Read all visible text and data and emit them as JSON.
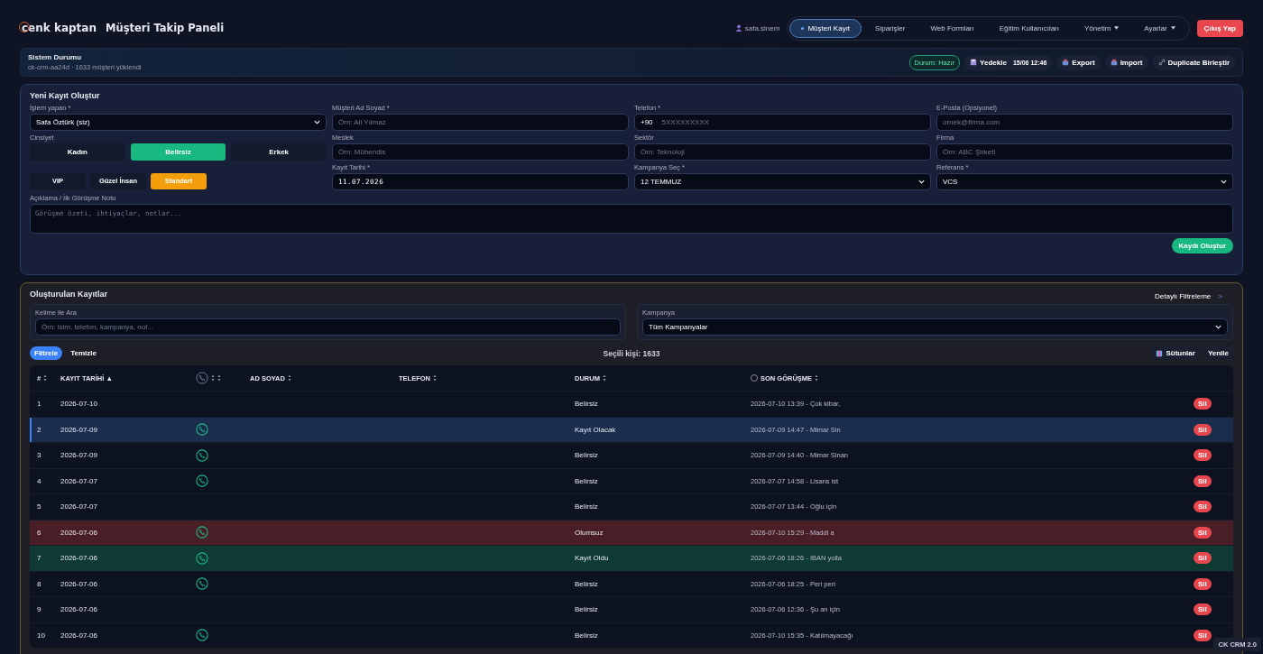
{
  "brand": {
    "logo": "cenk kaptan",
    "title": "Müşteri Takip Paneli"
  },
  "user": "safa.sinem",
  "nav": [
    {
      "label": "Müşteri Kayıt",
      "selected": true,
      "dropdown": false
    },
    {
      "label": "Siparişler",
      "selected": false,
      "dropdown": false
    },
    {
      "label": "Web Formları",
      "selected": false,
      "dropdown": false
    },
    {
      "label": "Eğitim Kullanıcıları",
      "selected": false,
      "dropdown": false
    },
    {
      "label": "Yönetim",
      "selected": false,
      "dropdown": true
    },
    {
      "label": "Ayarlar",
      "selected": false,
      "dropdown": true
    }
  ],
  "logout": "Çıkış Yap",
  "system": {
    "title": "Sistem Durumu",
    "subtitle": "ck-crm-aa24d · 1633 müşteri yüklendi",
    "status": "Durum: Hazır",
    "backup": "Yedekle",
    "backup_time": "15/06 12:46",
    "actions": [
      {
        "kind": "export",
        "label": "Export"
      },
      {
        "kind": "import",
        "label": "Import"
      },
      {
        "kind": "link",
        "label": "Duplicate Birleştir"
      }
    ]
  },
  "form": {
    "title": "Yeni Kayıt Oluştur",
    "operator": {
      "label": "İşlem yapan *",
      "value": "Safa Öztürk (siz)"
    },
    "name": {
      "label": "Müşteri Ad Soyad *",
      "placeholder": "Örn: Ali Yılmaz"
    },
    "phone": {
      "label": "Telefon *",
      "prefix": "+90",
      "placeholder": "5XXXXXXXXX"
    },
    "email": {
      "label": "E-Posta (Opsiyonel)",
      "placeholder": "ornek@firma.com"
    },
    "gender": {
      "label": "Cinsiyet",
      "options": [
        {
          "label": "Kadın",
          "selected": false
        },
        {
          "label": "Belirsiz",
          "selected": true
        },
        {
          "label": "Erkek",
          "selected": false
        }
      ]
    },
    "job": {
      "label": "Meslek",
      "placeholder": "Örn: Mühendis"
    },
    "sector": {
      "label": "Sektör",
      "placeholder": "Örn: Teknoloji"
    },
    "company": {
      "label": "Firma",
      "placeholder": "Örn: ABC Şirketi"
    },
    "segments": [
      {
        "label": "VIP",
        "selected": false
      },
      {
        "label": "Güzel İnsan",
        "selected": false
      },
      {
        "label": "Standart",
        "selected": true
      }
    ],
    "date": {
      "label": "Kayıt Tarihi *",
      "value": "11.07.2026"
    },
    "campaign": {
      "label": "Kampanya Seç *",
      "value": "12 TEMMUZ"
    },
    "reference": {
      "label": "Referans *",
      "value": "VCS"
    },
    "note": {
      "label": "Açıklama / İlk Görüşme Notu",
      "placeholder": "Görüşme özeti, ihtiyaçlar, notlar..."
    },
    "submit": "Kaydı Oluştur"
  },
  "records": {
    "title": "Oluşturulan Kayıtlar",
    "detail_filter": "Detaylı Filtreleme",
    "detail_arrow": ">",
    "search": {
      "label": "Kelime ile Ara",
      "placeholder": "Örn: isim, telefon, kampanya, not..."
    },
    "campaign": {
      "label": "Kampanya",
      "value": "Tüm Kampanyalar"
    },
    "filter": "Filtrele",
    "clear": "Temizle",
    "selected_count": "Seçili kişi: 1633",
    "columns_button": "Sütunlar",
    "refresh": "Yenile",
    "columns": [
      "#",
      "KAYIT TARİHİ ▲",
      "AD SOYAD",
      "TELEFON",
      "DURUM",
      "SON GÖRÜŞME"
    ],
    "rows": [
      {
        "no": "1",
        "date": "2026-07-10",
        "has_call": false,
        "status": "Belirsiz",
        "kind": "plain",
        "last": "2026-07-10 13:39 - Çok kibar,",
        "delete": "Sil"
      },
      {
        "no": "2",
        "date": "2026-07-09",
        "has_call": true,
        "status": "Kayıt Olacak",
        "kind": "planned",
        "last": "2026-07-09 14:47 - Mimar Sin",
        "delete": "Sil"
      },
      {
        "no": "3",
        "date": "2026-07-09",
        "has_call": true,
        "status": "Belirsiz",
        "kind": "plain",
        "last": "2026-07-09 14:40 - Mimar Sinan",
        "delete": "Sil"
      },
      {
        "no": "4",
        "date": "2026-07-07",
        "has_call": true,
        "status": "Belirsiz",
        "kind": "plain",
        "last": "2026-07-07 14:58 - Lisans ist",
        "delete": "Sil"
      },
      {
        "no": "5",
        "date": "2026-07-07",
        "has_call": false,
        "status": "Belirsiz",
        "kind": "plain",
        "last": "2026-07-07 13:44 - Oğlu için",
        "delete": "Sil"
      },
      {
        "no": "6",
        "date": "2026-07-06",
        "has_call": true,
        "status": "Olumsuz",
        "kind": "negative",
        "last": "2026-07-10 15:29 - Maddi a",
        "delete": "Sil"
      },
      {
        "no": "7",
        "date": "2026-07-06",
        "has_call": true,
        "status": "Kayıt Oldu",
        "kind": "positive",
        "last": "2026-07-06 18:26 - IBAN yolla",
        "delete": "Sil"
      },
      {
        "no": "8",
        "date": "2026-07-06",
        "has_call": true,
        "status": "Belirsiz",
        "kind": "plain",
        "last": "2026-07-06 18:25 - Peri peri",
        "delete": "Sil"
      },
      {
        "no": "9",
        "date": "2026-07-06",
        "has_call": false,
        "status": "Belirsiz",
        "kind": "plain",
        "last": "2026-07-06 12:36 - Şu an için",
        "delete": "Sil"
      },
      {
        "no": "10",
        "date": "2026-07-06",
        "has_call": true,
        "status": "Belirsiz",
        "kind": "plain",
        "last": "2026-07-10 15:35 - Katılmayacağı",
        "delete": "Sil"
      }
    ]
  },
  "version_badge": "CK CRM 2.0"
}
